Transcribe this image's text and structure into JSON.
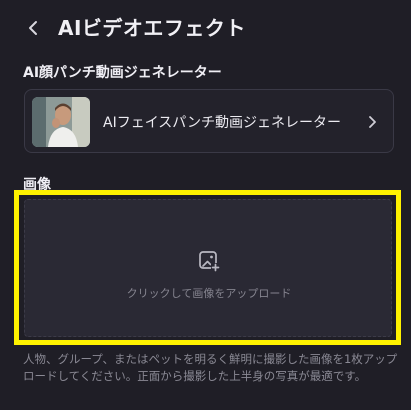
{
  "header": {
    "title": "AIビデオエフェクト",
    "back_icon": "chevron-left-icon"
  },
  "generator": {
    "section_label": "AI顔パンチ動画ジェネレーター",
    "card_label": "AIフェイスパンチ動画ジェネレーター",
    "chevron_icon": "chevron-right-icon"
  },
  "image": {
    "section_label": "画像",
    "upload_text": "クリックして画像をアップロード",
    "upload_icon": "image-add-icon",
    "hint": "人物、グループ、またはペットを明るく鮮明に撮影した画像を1枚アップロードしてください。正面から撮影した上半身の写真が最適です。"
  },
  "colors": {
    "background": "#1f1e26",
    "highlight": "#fff200"
  }
}
